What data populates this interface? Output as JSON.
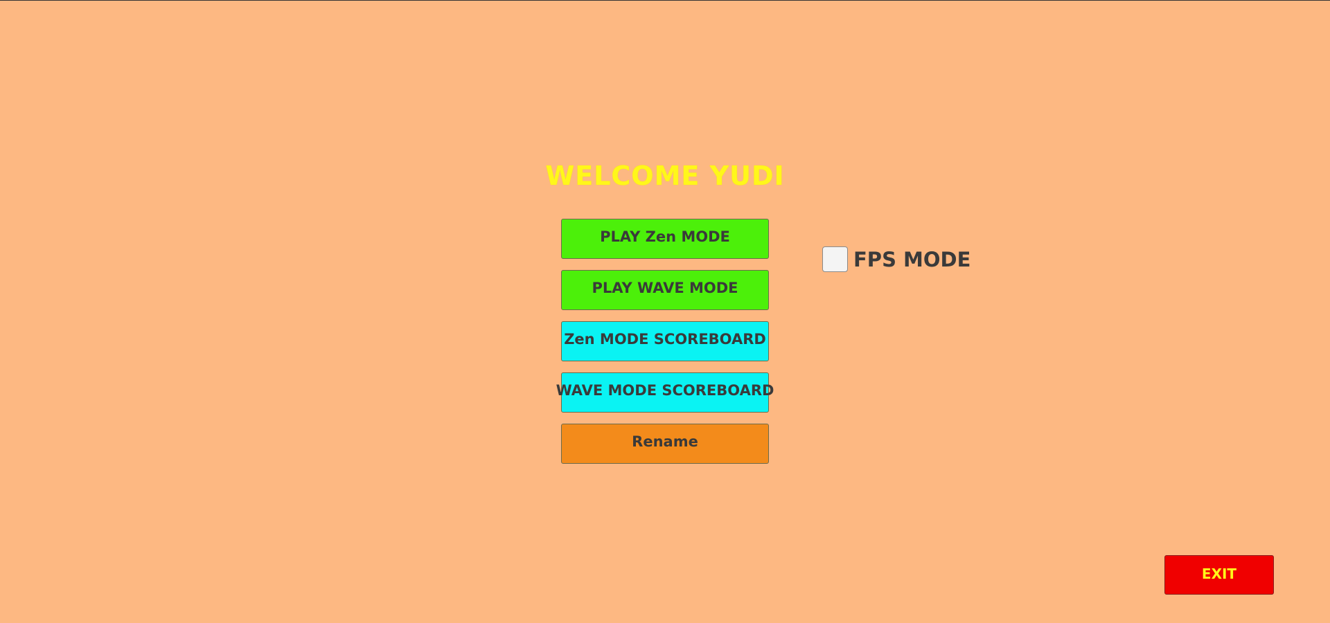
{
  "colors": {
    "background": "#FDB882",
    "welcome_text": "#FFF71A",
    "play_button": "#4CF00A",
    "scoreboard_button": "#0AF3F3",
    "rename_button": "#F38B1B",
    "exit_button": "#F00000",
    "exit_text": "#FFF71A",
    "button_text": "#3A3A3A"
  },
  "header": {
    "welcome": "WELCOME YUDI"
  },
  "menu": {
    "play_zen": "PLAY Zen MODE",
    "play_wave": "PLAY WAVE MODE",
    "zen_scoreboard": "Zen MODE SCOREBOARD",
    "wave_scoreboard": "WAVE MODE SCOREBOARD",
    "rename": "Rename"
  },
  "options": {
    "fps_label": "FPS MODE",
    "fps_checked": false
  },
  "exit": {
    "label": "EXIT"
  }
}
